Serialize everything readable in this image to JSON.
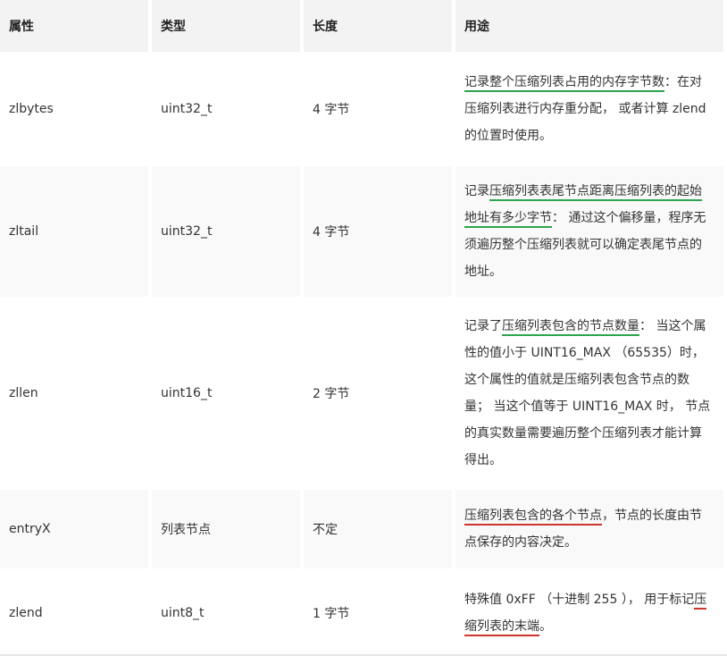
{
  "headers": [
    "属性",
    "类型",
    "长度",
    "用途"
  ],
  "rows": [
    {
      "name": "zlbytes",
      "type": "uint32_t",
      "length": "4 字节",
      "desc": [
        {
          "t": "记录整个压缩列表占用的内存字节数",
          "u": "green"
        },
        {
          "t": "：在对压缩列表进行内存重分配， 或者计算 zlend 的位置时使用。",
          "u": ""
        }
      ]
    },
    {
      "name": "zltail",
      "type": "uint32_t",
      "length": "4 字节",
      "desc": [
        {
          "t": "记录",
          "u": ""
        },
        {
          "t": "压缩列表表尾节点距离压缩列表的起始地址有多少字节",
          "u": "green"
        },
        {
          "t": "： 通过这个偏移量，程序无须遍历整个压缩列表就可以确定表尾节点的地址。",
          "u": ""
        }
      ]
    },
    {
      "name": "zllen",
      "type": "uint16_t",
      "length": "2 字节",
      "desc": [
        {
          "t": "记录了",
          "u": ""
        },
        {
          "t": "压缩列表包含的节点数量",
          "u": "green"
        },
        {
          "t": "： 当这个属性的值小于 UINT16_MAX （65535）时， 这个属性的值就是压缩列表包含节点的数量； 当这个值等于 UINT16_MAX 时， 节点的真实数量需要遍历整个压缩列表才能计算得出。",
          "u": ""
        }
      ]
    },
    {
      "name": "entryX",
      "type": "列表节点",
      "length": "不定",
      "desc": [
        {
          "t": "压缩列表包含的各个节点",
          "u": "red"
        },
        {
          "t": "，节点的长度由节点保存的内容决定。",
          "u": ""
        }
      ]
    },
    {
      "name": "zlend",
      "type": "uint8_t",
      "length": "1 字节",
      "desc": [
        {
          "t": "特殊值 0xFF （十进制 255 ）， 用于标记",
          "u": ""
        },
        {
          "t": "压缩列表的末端",
          "u": "red"
        },
        {
          "t": "。",
          "u": ""
        }
      ]
    }
  ]
}
